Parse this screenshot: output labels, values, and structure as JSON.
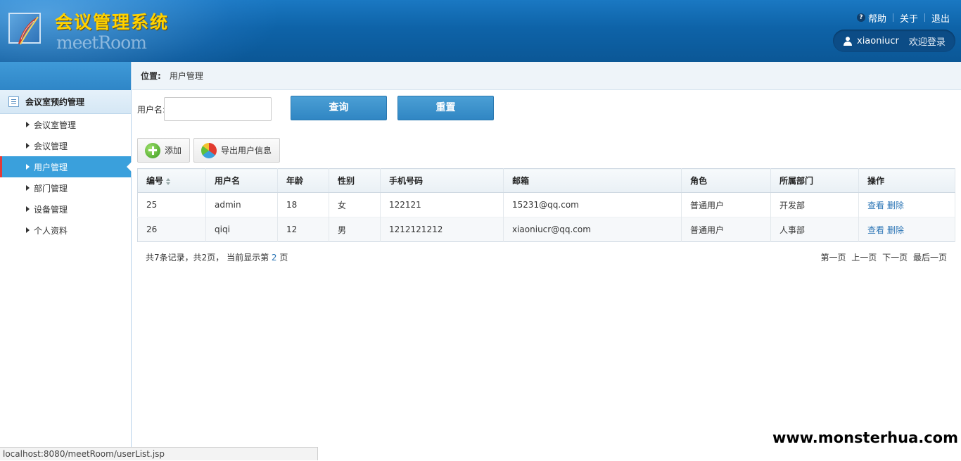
{
  "header": {
    "title": "会议管理系统",
    "subtitle": "meetRoom",
    "links": {
      "help": "帮助",
      "about": "关于",
      "logout": "退出"
    },
    "user": {
      "name": "xiaoniucr",
      "welcome": "欢迎登录"
    }
  },
  "breadcrumb": {
    "label": "位置:",
    "current": "用户管理"
  },
  "sidebar": {
    "section_title": "会议室预约管理",
    "items": [
      {
        "label": "会议室管理"
      },
      {
        "label": "会议管理"
      },
      {
        "label": "用户管理"
      },
      {
        "label": "部门管理"
      },
      {
        "label": "设备管理"
      },
      {
        "label": "个人资料"
      }
    ]
  },
  "search": {
    "label": "用户名:",
    "value": "",
    "query_label": "查询",
    "reset_label": "重置"
  },
  "toolbar": {
    "add_label": "添加",
    "export_label": "导出用户信息"
  },
  "table": {
    "headers": [
      "编号",
      "用户名",
      "年龄",
      "性别",
      "手机号码",
      "邮箱",
      "角色",
      "所属部门",
      "操作"
    ],
    "rows": [
      {
        "id": "25",
        "username": "admin",
        "age": "18",
        "gender": "女",
        "phone": "122121",
        "email": "15231@qq.com",
        "role": "普通用户",
        "dept": "开发部",
        "view": "查看",
        "delete": "删除"
      },
      {
        "id": "26",
        "username": "qiqi",
        "age": "12",
        "gender": "男",
        "phone": "1212121212",
        "email": "xiaoniucr@qq.com",
        "role": "普通用户",
        "dept": "人事部",
        "view": "查看",
        "delete": "删除"
      }
    ]
  },
  "pager": {
    "summary_prefix": "共7条记录，共2页，  当前显示第",
    "current_page": "2",
    "summary_suffix": "页",
    "first": "第一页",
    "prev": "上一页",
    "next": "下一页",
    "last": "最后一页"
  },
  "statusbar": {
    "url": "localhost:8080/meetRoom/userList.jsp"
  },
  "watermark": "www.monsterhua.com",
  "colors": {
    "header": "#0e63a8",
    "accent": "#3aa0dc",
    "title": "#ffd200",
    "active_marker": "#e23a3a",
    "link": "#2a74b5"
  }
}
